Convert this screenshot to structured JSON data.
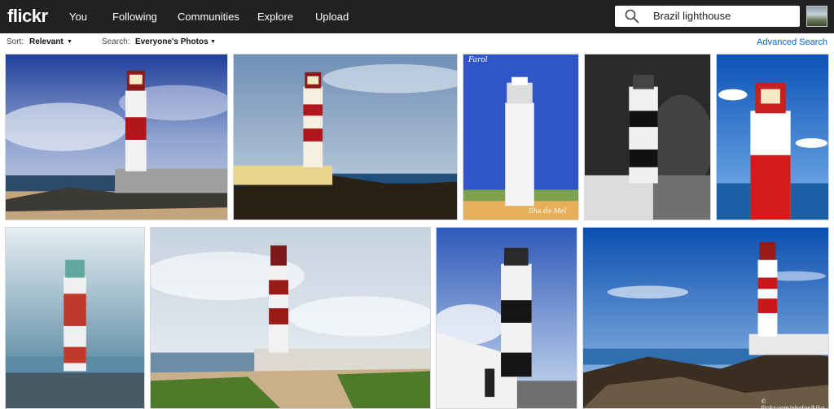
{
  "header": {
    "logo": "flickr",
    "nav": [
      "You",
      "Following",
      "Communities",
      "Explore",
      "Upload"
    ],
    "search_value": "Brazil lighthouse",
    "search_icon": "magnifier",
    "avatar": "user-avatar"
  },
  "subbar": {
    "sort_label": "Sort:",
    "sort_value": "Relevant",
    "search_label": "Search:",
    "search_value": "Everyone's Photos",
    "advanced": "Advanced Search"
  },
  "photos": [
    {
      "id": "p1",
      "desc": "lighthouse-red-white-stormy-sky"
    },
    {
      "id": "p2",
      "desc": "lighthouse-red-white-blue-sky"
    },
    {
      "id": "p3",
      "desc": "white-lighthouse-postcard",
      "watermark_top": "Farol",
      "watermark_bottom": "Ilha do Mel"
    },
    {
      "id": "p4",
      "desc": "black-white-lighthouse-bw"
    },
    {
      "id": "p5",
      "desc": "red-white-lighthouse-closeup"
    },
    {
      "id": "p6",
      "desc": "red-white-lighthouse-sea"
    },
    {
      "id": "p7",
      "desc": "lighthouse-beach-path"
    },
    {
      "id": "p8",
      "desc": "black-white-lighthouse-house"
    },
    {
      "id": "p9",
      "desc": "lighthouse-rocks-blue-sky",
      "watermark_bottom": "© flickr.com/photos/kiko"
    }
  ],
  "colors": {
    "topbar": "#212124",
    "link": "#0063dc",
    "tower_red": "#b0161c"
  }
}
